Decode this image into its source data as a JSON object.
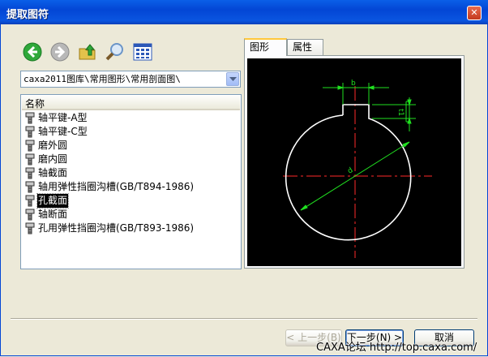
{
  "window": {
    "title": "提取图符",
    "close_glyph": "✕"
  },
  "toolbar": {
    "buttons": [
      {
        "name": "back",
        "icon": "back-arrow-icon",
        "color": "#2fa83a"
      },
      {
        "name": "forward",
        "icon": "forward-arrow-icon",
        "color": "#a8a8a8"
      },
      {
        "name": "up",
        "icon": "up-folder-icon",
        "color": "#e3c24b"
      },
      {
        "name": "search",
        "icon": "search-icon",
        "color": "#6b95c8"
      },
      {
        "name": "view",
        "icon": "view-grid-icon",
        "color": "#2c58b8"
      }
    ]
  },
  "path": {
    "value": "caxa2011图库\\常用图形\\常用剖面图\\"
  },
  "list": {
    "header": "名称",
    "items": [
      "轴平键-A型",
      "轴平键-C型",
      "磨外圆",
      "磨内圆",
      "轴截面",
      "轴用弹性挡圈沟槽(GB/T894-1986)",
      "孔截面",
      "轴断面",
      "孔用弹性挡圈沟槽(GB/T893-1986)"
    ],
    "selected_index": 6
  },
  "tabs": [
    {
      "label": "图形",
      "active": true
    },
    {
      "label": "属性",
      "active": false
    }
  ],
  "preview": {
    "dim_labels": {
      "width": "b",
      "depth": "t1",
      "diameter": "d"
    },
    "colors": {
      "outline": "#ffffff",
      "centerline": "#ff2a2a",
      "dimension": "#20e020"
    }
  },
  "buttons": {
    "prev": "< 上一步(B)",
    "next": "下一步(N) >",
    "cancel": "取消"
  },
  "watermark": "CAXA论坛 http://top.caxa.com/"
}
